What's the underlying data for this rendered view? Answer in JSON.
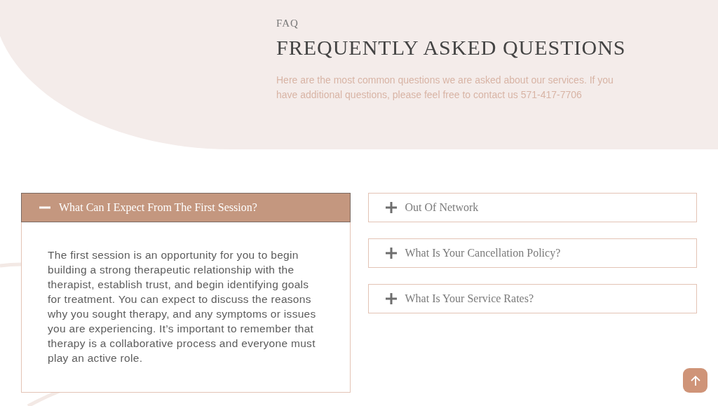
{
  "header": {
    "eyebrow": "FAQ",
    "title": "FREQUENTLY ASKED QUESTIONS",
    "intro": "Here are the most common questions we are asked about our services. If you have additional questions, please feel free to contact us 571-417-7706"
  },
  "left_column": [
    {
      "question": "What Can I Expect From The First Session?",
      "expanded": true,
      "answer": "The first session is an opportunity for you to begin building a strong therapeutic relationship with the therapist, establish trust, and begin identifying goals for treatment. You can expect to discuss the reasons why you sought therapy, and any symptoms or issues you are experiencing. It’s important to remember that therapy is a collaborative process and everyone must play an active role."
    }
  ],
  "right_column": [
    {
      "question": "Out Of Network",
      "expanded": false
    },
    {
      "question": "What Is Your Cancellation Policy?",
      "expanded": false
    },
    {
      "question": "What Is Your Service Rates?",
      "expanded": false
    }
  ]
}
